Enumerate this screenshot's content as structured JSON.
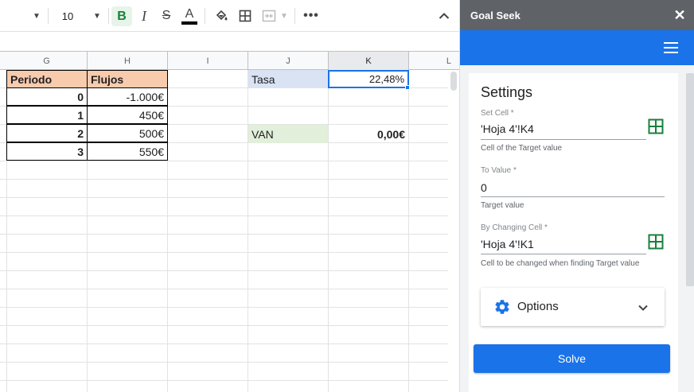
{
  "toolbar": {
    "font_size": "10",
    "bold_glyph": "B",
    "italic_glyph": "I",
    "strike_glyph": "S",
    "text_color_glyph": "A",
    "more_glyph": "•••",
    "icons": [
      "chevron-down-icon",
      "bold-icon",
      "italic-icon",
      "strikethrough-icon",
      "text-color-icon",
      "fill-color-icon",
      "borders-icon",
      "merge-cells-icon",
      "more-icon",
      "chevron-up-icon"
    ]
  },
  "columns": [
    {
      "label": "G"
    },
    {
      "label": "H"
    },
    {
      "label": "I"
    },
    {
      "label": "J"
    },
    {
      "label": "K",
      "selected": true
    },
    {
      "label": "L"
    }
  ],
  "cells": {
    "G1": "Periodo",
    "H1": "Flujos",
    "J1": "Tasa",
    "K1": "22,48%",
    "G2": "0",
    "H2": "-1.000€",
    "G3": "1",
    "H3": "450€",
    "G4": "2",
    "H4": "500€",
    "J4": "VAN",
    "K4": "0,00€",
    "G5": "3",
    "H5": "550€"
  },
  "panel": {
    "title": "Goal Seek",
    "close_glyph": "✕",
    "settings_title": "Settings",
    "set_cell": {
      "label": "Set Cell *",
      "value": "'Hoja 4'!K4",
      "hint": "Cell of the Target value"
    },
    "to_value": {
      "label": "To Value *",
      "value": "0",
      "hint": "Target value"
    },
    "changing_cell": {
      "label": "By Changing Cell *",
      "value": "'Hoja 4'!K1",
      "hint": "Cell to be changed when finding Target value"
    },
    "options_label": "Options",
    "solve_label": "Solve",
    "colors": {
      "appbar": "#1a73e8",
      "title_bar": "#5f6368",
      "grid_icon": "#188038"
    }
  }
}
